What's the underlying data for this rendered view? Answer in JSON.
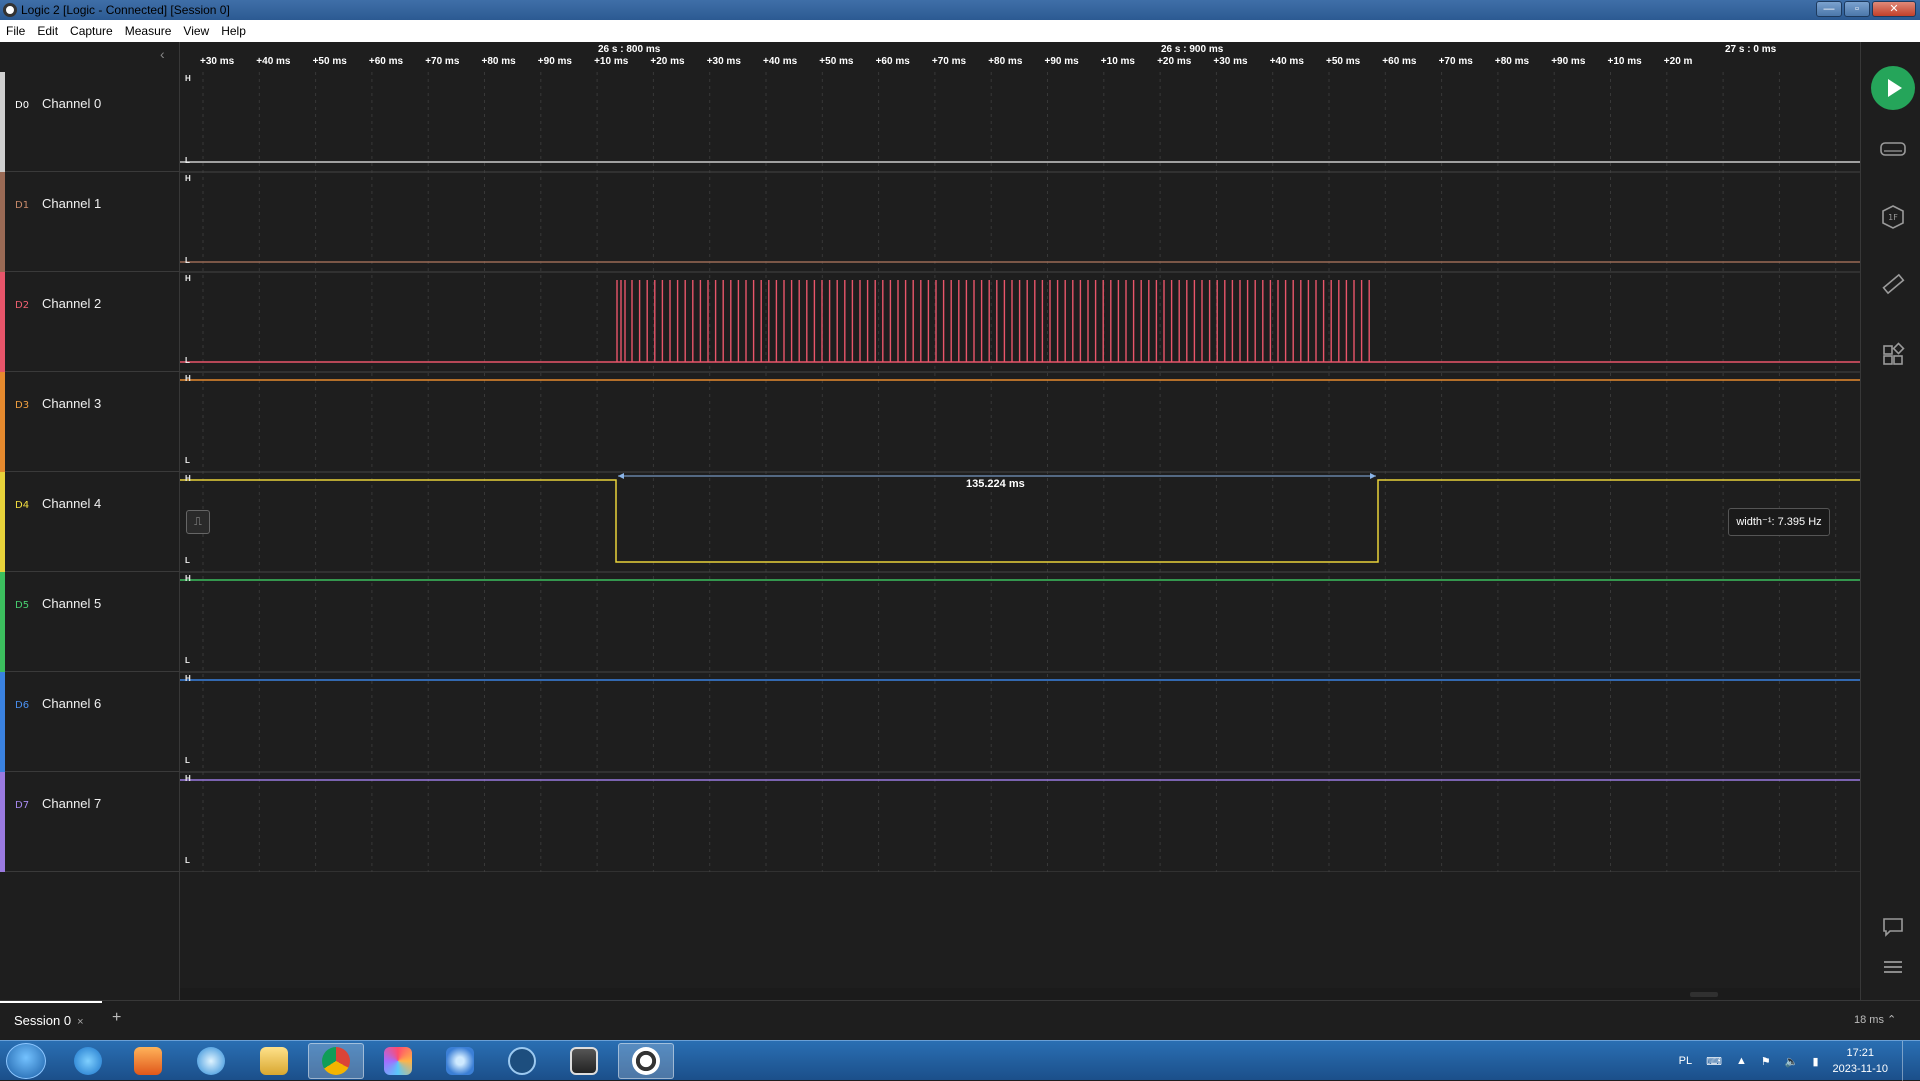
{
  "window": {
    "title": "Logic 2 [Logic - Connected] [Session 0]"
  },
  "menu": [
    "File",
    "Edit",
    "Capture",
    "Measure",
    "View",
    "Help"
  ],
  "channels": [
    {
      "d": "D0",
      "name": "Channel 0",
      "color": "#cccccc",
      "labelcolor": "#ffffff"
    },
    {
      "d": "D1",
      "name": "Channel 1",
      "color": "#9a6a55",
      "labelcolor": "#c98a6a"
    },
    {
      "d": "D2",
      "name": "Channel 2",
      "color": "#e8556a",
      "labelcolor": "#f06070"
    },
    {
      "d": "D3",
      "name": "Channel 3",
      "color": "#e68a2e",
      "labelcolor": "#f2a040"
    },
    {
      "d": "D4",
      "name": "Channel 4",
      "color": "#e8d23a",
      "labelcolor": "#f5e040"
    },
    {
      "d": "D5",
      "name": "Channel 5",
      "color": "#3cbf5e",
      "labelcolor": "#48d070"
    },
    {
      "d": "D6",
      "name": "Channel 6",
      "color": "#3a82e0",
      "labelcolor": "#4a90f0"
    },
    {
      "d": "D7",
      "name": "Channel 7",
      "color": "#9a7ae0",
      "labelcolor": "#a88af0"
    }
  ],
  "timeline": {
    "tick_labels": [
      "+30 ms",
      "+40 ms",
      "+50 ms",
      "+60 ms",
      "+70 ms",
      "+80 ms",
      "+90 ms",
      "+10 ms",
      "+20 ms",
      "+30 ms",
      "+40 ms",
      "+50 ms",
      "+60 ms",
      "+70 ms",
      "+80 ms",
      "+90 ms",
      "+10 ms",
      "+20 ms",
      "+30 ms",
      "+40 ms",
      "+50 ms",
      "+60 ms",
      "+70 ms",
      "+80 ms",
      "+90 ms",
      "+10 ms",
      "+20 m"
    ],
    "major_labels": [
      "26 s : 800 ms",
      "26 s : 900 ms",
      "27 s : 0 ms"
    ]
  },
  "measurement": {
    "pulse_width": "135.224 ms",
    "frequency": "width⁻¹: 7.395 Hz"
  },
  "levels": {
    "high": "H",
    "low": "L"
  },
  "tabs": {
    "session": "Session 0",
    "close": "×",
    "add": "+"
  },
  "zoom": "18 ms ⌃",
  "taskbar": {
    "lang": "PL",
    "time": "17:21",
    "date": "2023-11-10"
  }
}
